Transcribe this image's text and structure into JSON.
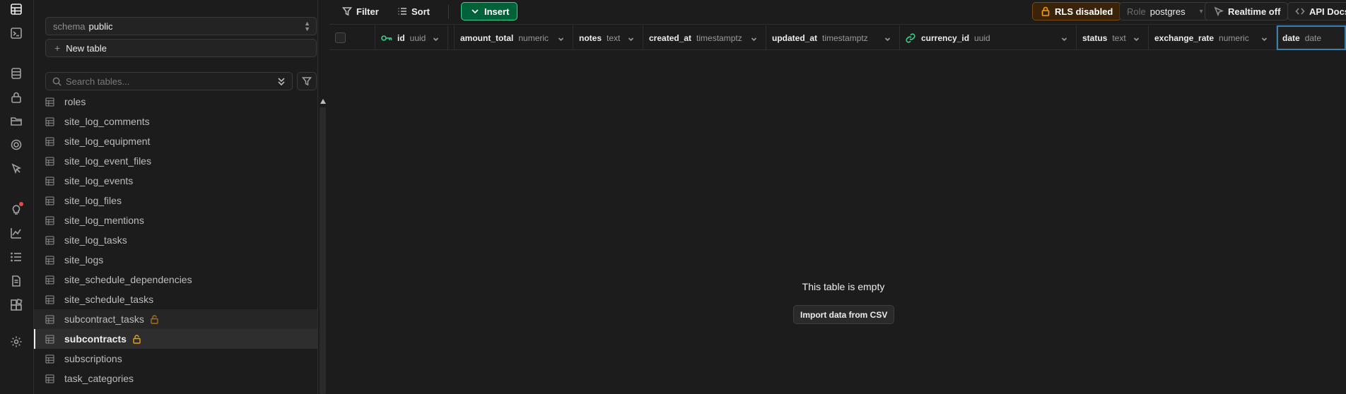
{
  "rail": {
    "icons": [
      "table-editor-icon",
      "sql-editor-icon",
      "database-icon",
      "auth-icon",
      "storage-icon",
      "edge-functions-icon",
      "realtime-icon",
      "advisors-icon",
      "reports-icon",
      "logs-icon",
      "api-docs-icon",
      "integrations-icon",
      "settings-icon"
    ]
  },
  "sidebar": {
    "schema_label": "schema",
    "schema_value": "public",
    "new_table_label": "New table",
    "search_placeholder": "Search tables...",
    "tables": [
      {
        "name": "roles",
        "state": "normal",
        "locked": false
      },
      {
        "name": "site_log_comments",
        "state": "normal",
        "locked": false
      },
      {
        "name": "site_log_equipment",
        "state": "normal",
        "locked": false
      },
      {
        "name": "site_log_event_files",
        "state": "normal",
        "locked": false
      },
      {
        "name": "site_log_events",
        "state": "normal",
        "locked": false
      },
      {
        "name": "site_log_files",
        "state": "normal",
        "locked": false
      },
      {
        "name": "site_log_mentions",
        "state": "normal",
        "locked": false
      },
      {
        "name": "site_log_tasks",
        "state": "normal",
        "locked": false
      },
      {
        "name": "site_logs",
        "state": "normal",
        "locked": false
      },
      {
        "name": "site_schedule_dependencies",
        "state": "normal",
        "locked": false
      },
      {
        "name": "site_schedule_tasks",
        "state": "normal",
        "locked": false
      },
      {
        "name": "subcontract_tasks",
        "state": "hover",
        "locked": true
      },
      {
        "name": "subcontracts",
        "state": "active",
        "locked": true
      },
      {
        "name": "subscriptions",
        "state": "normal",
        "locked": false
      },
      {
        "name": "task_categories",
        "state": "normal",
        "locked": false
      },
      {
        "name": "",
        "state": "normal",
        "locked": false
      }
    ]
  },
  "toolbar": {
    "filter_label": "Filter",
    "sort_label": "Sort",
    "insert_label": "Insert",
    "rls_label": "RLS disabled",
    "role_key": "Role",
    "role_value": "postgres",
    "realtime_label": "Realtime off",
    "api_docs_label": "API Docs"
  },
  "grid": {
    "columns": [
      {
        "name": "id",
        "type": "uuid",
        "key": "primary"
      },
      {
        "name": "amount_total",
        "type": "numeric"
      },
      {
        "name": "notes",
        "type": "text"
      },
      {
        "name": "created_at",
        "type": "timestamptz"
      },
      {
        "name": "updated_at",
        "type": "timestamptz"
      },
      {
        "name": "currency_id",
        "type": "uuid",
        "key": "foreign"
      },
      {
        "name": "status",
        "type": "text"
      },
      {
        "name": "exchange_rate",
        "type": "numeric"
      },
      {
        "name": "date",
        "type": "date"
      }
    ],
    "empty_message": "This table is empty",
    "import_label": "Import data from CSV"
  },
  "colors": {
    "background": "#1c1c1c",
    "accent_green": "#3ecf8e",
    "insert_bg": "#006239",
    "warning": "#f1a10d"
  }
}
